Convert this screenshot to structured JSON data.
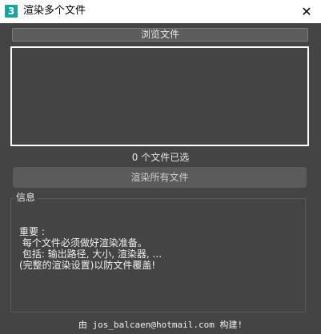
{
  "window": {
    "title": "渲染多个文件",
    "app_icon_glyph": "3",
    "close_glyph": "✕"
  },
  "browse_button": {
    "label": "浏览文件"
  },
  "file_list": {
    "items": []
  },
  "selection_status": "0 个文件已选",
  "render_button": {
    "label": "渲染所有文件"
  },
  "info": {
    "legend": "信息",
    "text": "重要 :\n 每个文件必须做好渲染准备。\n 包括: 输出路径, 大小, 渲染器, ...\n(完整的渲染设置)以防文件覆盖!"
  },
  "credit": "由 jos_balcaen@hotmail.com 构建!",
  "colors": {
    "background": "#444444",
    "titlebar": "#ffffff",
    "app_icon": "#1aa3a3",
    "list_border": "#ffffff"
  }
}
